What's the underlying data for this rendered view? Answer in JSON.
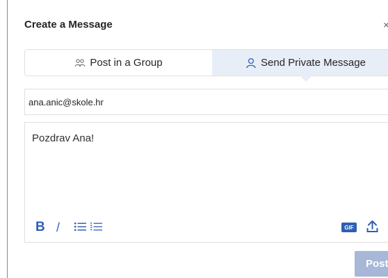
{
  "dialog": {
    "title": "Create a Message",
    "close_glyph": "×"
  },
  "tabs": [
    {
      "label": "Post in a Group",
      "icon": "group-icon",
      "active": false
    },
    {
      "label": "Send Private Message",
      "icon": "person-icon",
      "active": true
    }
  ],
  "recipient": {
    "value": "ana.anic@skole.hr"
  },
  "editor": {
    "text": "Pozdrav Ana!"
  },
  "toolbar": {
    "bold_label": "B",
    "italic_label": "/",
    "gif_label": "GIF",
    "icons": [
      "bold-icon",
      "italic-icon",
      "bulleted-list-icon",
      "numbered-list-icon",
      "gif-icon",
      "upload-icon"
    ]
  },
  "actions": {
    "post_label": "Post"
  },
  "colors": {
    "accent": "#2f5fb3",
    "post_button_disabled": "#a6b7d8",
    "active_tab_bg": "#e8eef8"
  }
}
